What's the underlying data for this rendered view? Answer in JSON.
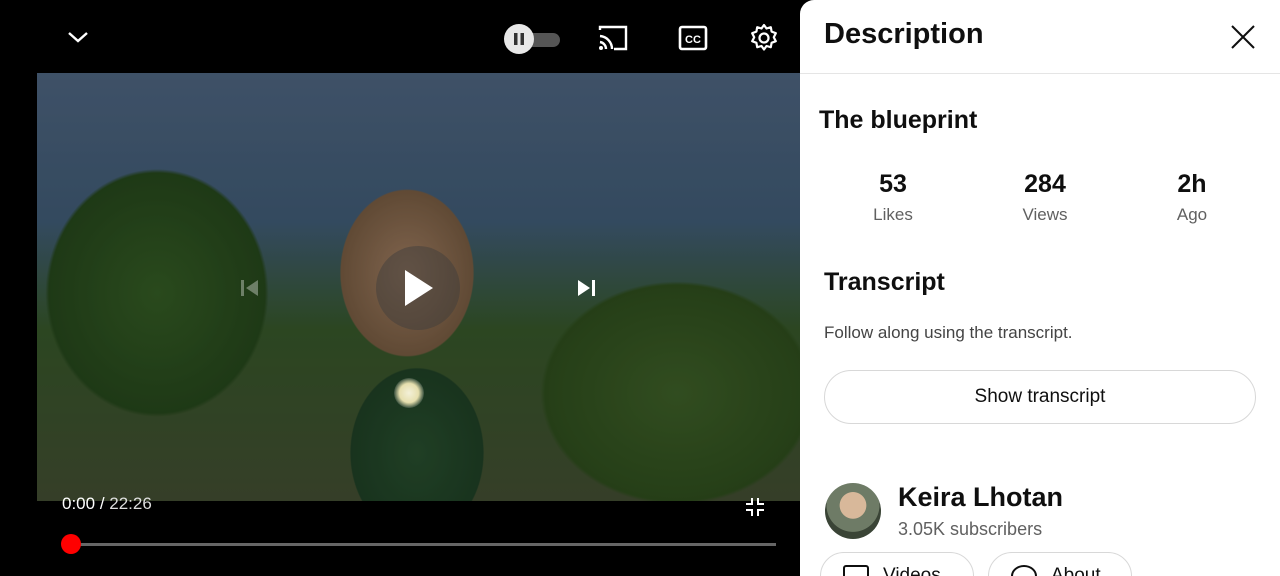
{
  "player": {
    "time_current": "0:00",
    "time_separator": " / ",
    "time_duration": "22:26",
    "progress_fraction": 0.0,
    "autoplay_on": false,
    "scrubber_color": "#ff0000"
  },
  "panel": {
    "title": "Description",
    "video_title": "The blueprint",
    "stats": [
      {
        "value": "53",
        "label": "Likes"
      },
      {
        "value": "284",
        "label": "Views"
      },
      {
        "value": "2h",
        "label": "Ago"
      }
    ],
    "transcript": {
      "heading": "Transcript",
      "subtitle": "Follow along using the transcript.",
      "button": "Show transcript"
    },
    "channel": {
      "name": "Keira Lhotan",
      "subscribers": "3.05K subscribers"
    },
    "pills": [
      {
        "label": "Videos",
        "icon": "video-icon"
      },
      {
        "label": "About",
        "icon": "account-icon"
      }
    ]
  }
}
